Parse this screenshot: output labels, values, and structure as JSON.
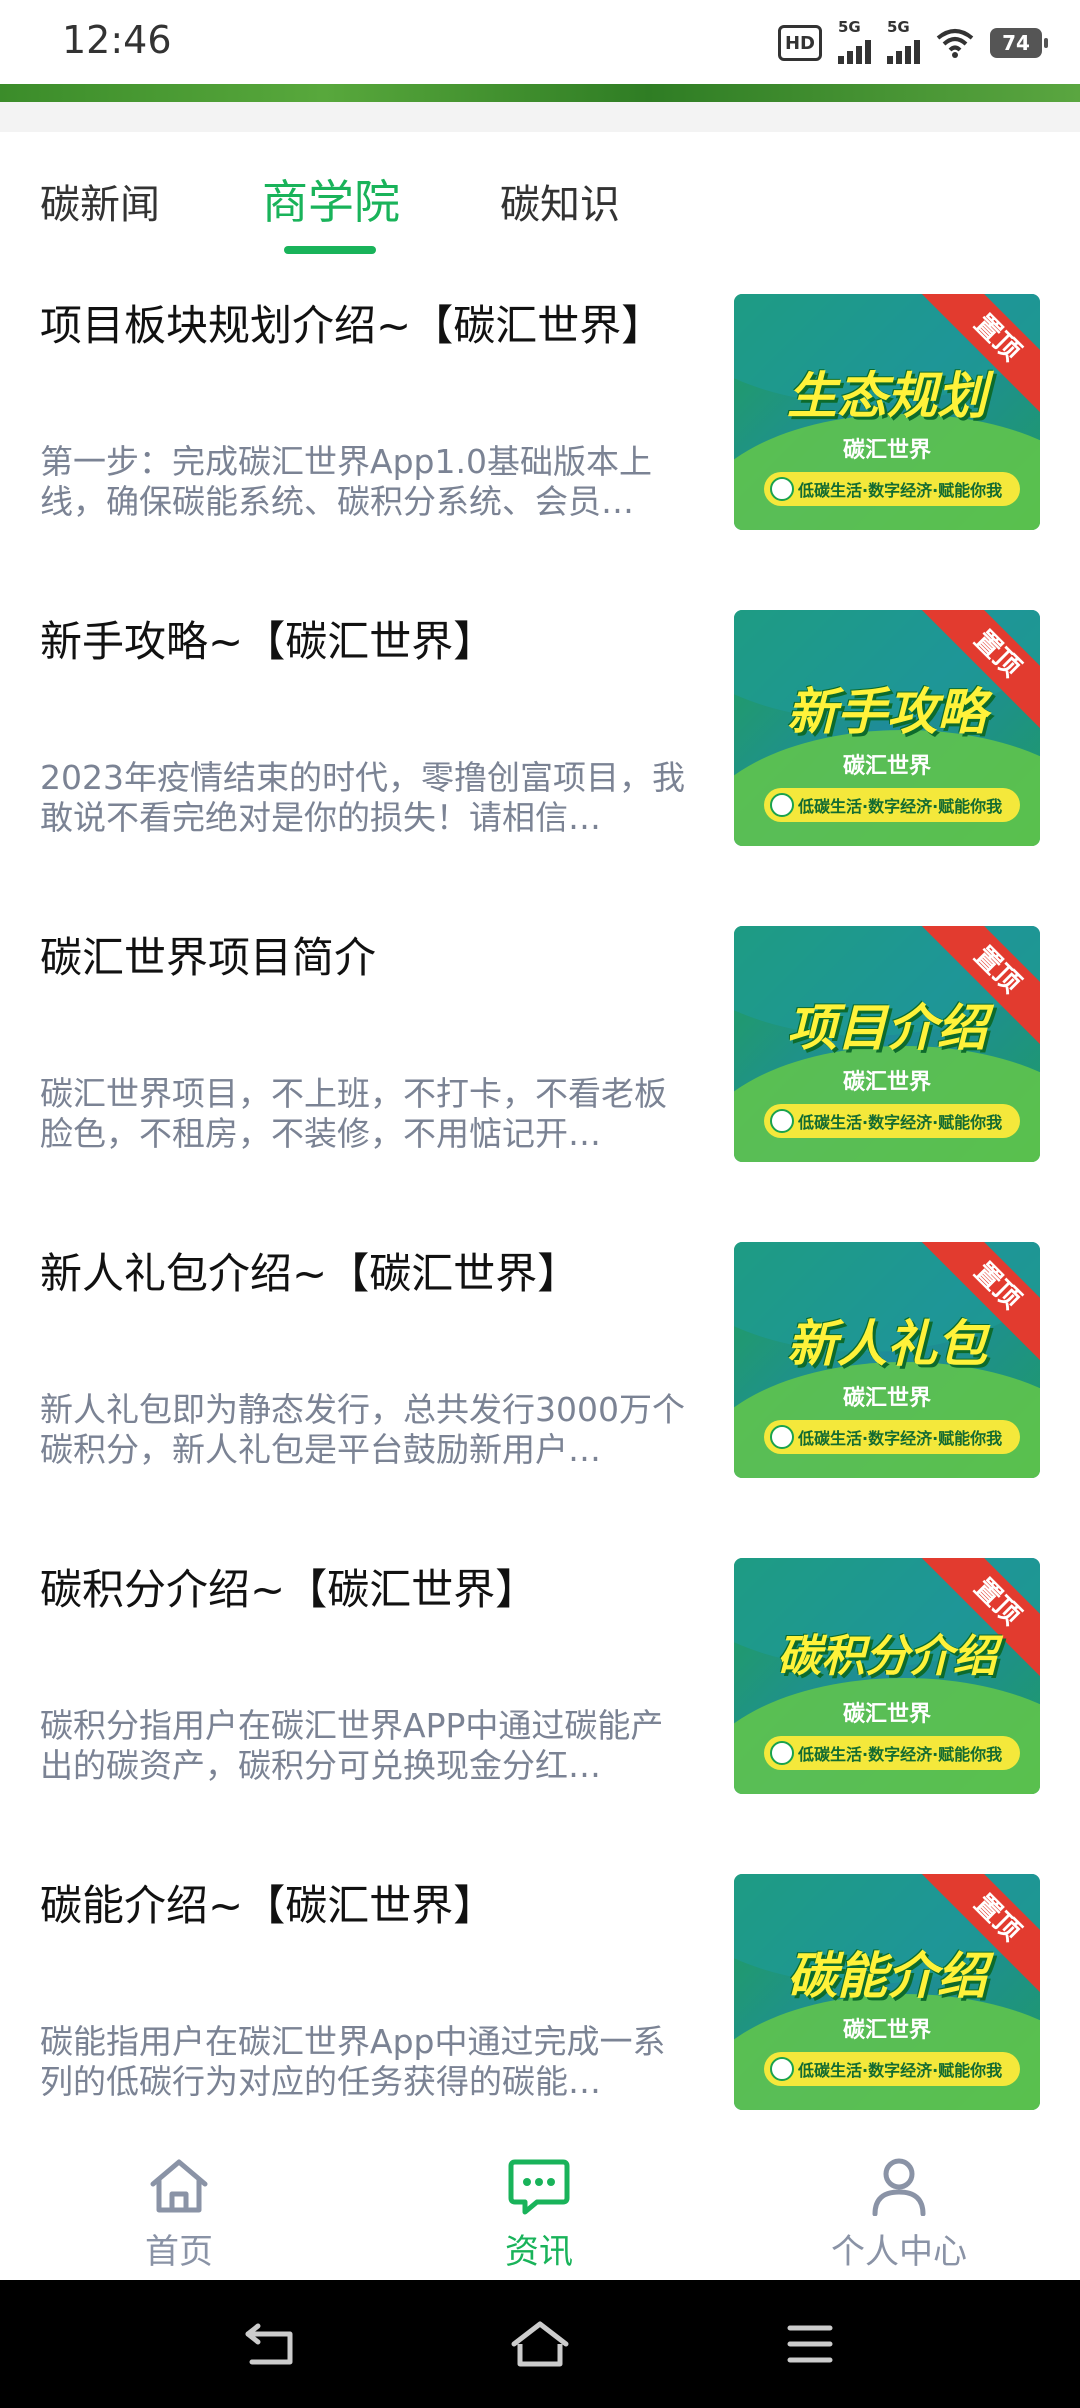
{
  "status_bar": {
    "time": "12:46",
    "hd_label": "HD",
    "signal1_label": "5G",
    "signal2_label": "5G",
    "battery": "74"
  },
  "tabs": [
    {
      "label": "碳新闻",
      "active": false
    },
    {
      "label": "商学院",
      "active": true
    },
    {
      "label": "碳知识",
      "active": false
    }
  ],
  "accent_color": "#19b35a",
  "articles": [
    {
      "title": "项目板块规划介绍~【碳汇世界】",
      "summary": "第一步：完成碳汇世界App1.0基础版本上线，确保碳能系统、碳积分系统、会员…",
      "thumb_title": "生态规划",
      "thumb_brand": "碳汇世界",
      "thumb_tagline": "低碳生活·数字经济·赋能你我",
      "thumb_ribbon": "置顶"
    },
    {
      "title": "新手攻略~【碳汇世界】",
      "summary": "2023年疫情结束的时代，零撸创富项目，我敢说不看完绝对是你的损失！请相信…",
      "thumb_title": "新手攻略",
      "thumb_brand": "碳汇世界",
      "thumb_tagline": "低碳生活·数字经济·赋能你我",
      "thumb_ribbon": "置顶"
    },
    {
      "title": "碳汇世界项目简介",
      "summary": "碳汇世界项目，不上班，不打卡，不看老板脸色，不租房，不装修，不用惦记开…",
      "thumb_title": "项目介绍",
      "thumb_brand": "碳汇世界",
      "thumb_tagline": "低碳生活·数字经济·赋能你我",
      "thumb_ribbon": "置顶"
    },
    {
      "title": "新人礼包介绍~【碳汇世界】",
      "summary": "新人礼包即为静态发行，总共发行3000万个碳积分，新人礼包是平台鼓励新用户…",
      "thumb_title": "新人礼包",
      "thumb_brand": "碳汇世界",
      "thumb_tagline": "低碳生活·数字经济·赋能你我",
      "thumb_ribbon": "置顶"
    },
    {
      "title": "碳积分介绍~【碳汇世界】",
      "summary": "碳积分指用户在碳汇世界APP中通过碳能产出的碳资产，碳积分可兑换现金分红…",
      "thumb_title": "碳积分介绍",
      "thumb_brand": "碳汇世界",
      "thumb_tagline": "低碳生活·数字经济·赋能你我",
      "thumb_ribbon": "置顶"
    },
    {
      "title": "碳能介绍~【碳汇世界】",
      "summary": "碳能指用户在碳汇世界App中通过完成一系列的低碳行为对应的任务获得的碳能…",
      "thumb_title": "碳能介绍",
      "thumb_brand": "碳汇世界",
      "thumb_tagline": "低碳生活·数字经济·赋能你我",
      "thumb_ribbon": "置顶"
    }
  ],
  "bottom_nav": [
    {
      "label": "首页",
      "icon": "home-icon",
      "active": false
    },
    {
      "label": "资讯",
      "icon": "chat-icon",
      "active": true
    },
    {
      "label": "个人中心",
      "icon": "user-icon",
      "active": false
    }
  ],
  "system_nav": {
    "back_icon": "back-icon",
    "home_icon": "home-outline-icon",
    "menu_icon": "menu-icon"
  }
}
